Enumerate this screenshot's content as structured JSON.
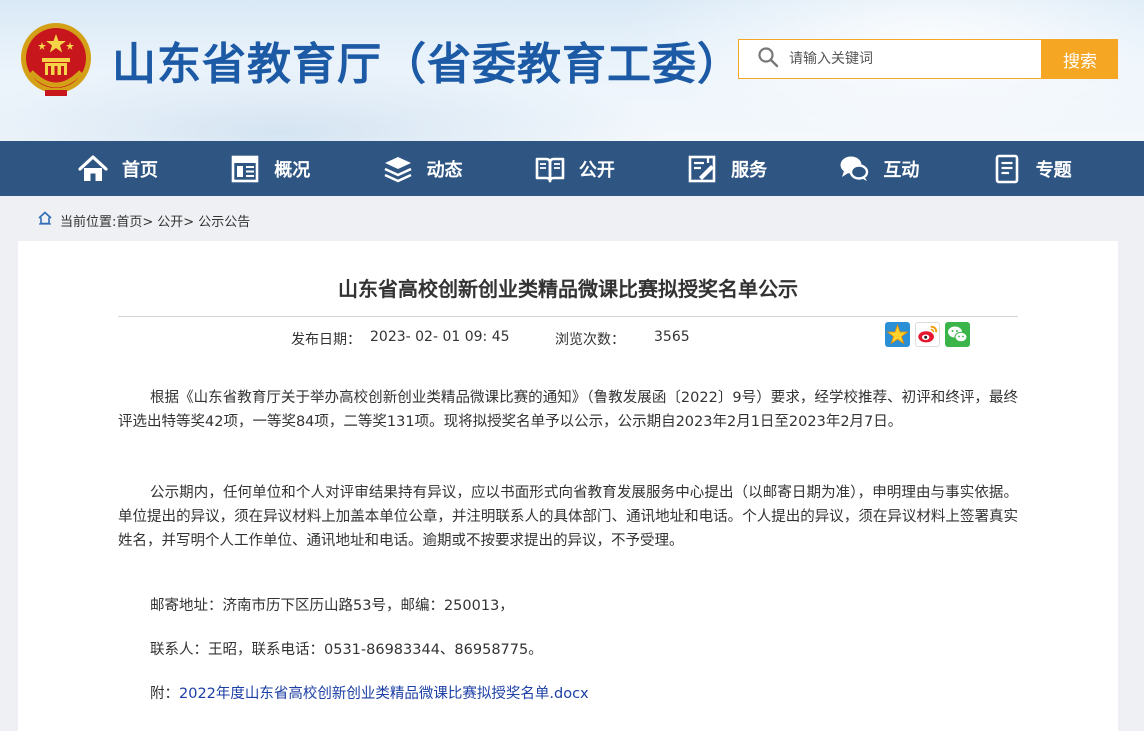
{
  "header": {
    "site_title": "山东省教育厅（省委教育工委）",
    "search_placeholder": "请输入关键词",
    "search_button": "搜索"
  },
  "nav": {
    "items": [
      {
        "label": "首页",
        "icon": "home-icon"
      },
      {
        "label": "概况",
        "icon": "overview-icon"
      },
      {
        "label": "动态",
        "icon": "news-stack-icon"
      },
      {
        "label": "公开",
        "icon": "open-book-icon"
      },
      {
        "label": "服务",
        "icon": "service-icon"
      },
      {
        "label": "互动",
        "icon": "chat-bubbles-icon"
      },
      {
        "label": "专题",
        "icon": "document-icon"
      }
    ]
  },
  "breadcrumb": {
    "prefix": "当前位置:",
    "items": [
      "首页>",
      "公开>",
      "公示公告"
    ]
  },
  "article": {
    "title": "山东省高校创新创业类精品微课比赛拟授奖名单公示",
    "publish_label": "发布日期：",
    "publish_date": "2023- 02- 01 09: 45",
    "views_label": "浏览次数：",
    "views_count": "3565",
    "share_icons": [
      "share-star-icon",
      "weibo-icon",
      "wechat-icon"
    ],
    "paragraph1": "根据《山东省教育厅关于举办高校创新创业类精品微课比赛的通知》（鲁教发展函〔2022〕9号）要求，经学校推荐、初评和终评，最终评选出特等奖42项，一等奖84项，二等奖131项。现将拟授奖名单予以公示，公示期自2023年2月1日至2023年2月7日。",
    "paragraph2": "公示期内，任何单位和个人对评审结果持有异议，应以书面形式向省教育发展服务中心提出（以邮寄日期为准），申明理由与事实依据。单位提出的异议，须在异议材料上加盖本单位公章，并注明联系人的具体部门、通讯地址和电话。个人提出的异议，须在异议材料上签署真实姓名，并写明个人工作单位、通讯地址和电话。逾期或不按要求提出的异议，不予受理。",
    "address": "邮寄地址：济南市历下区历山路53号，邮编：250013，",
    "contact": "联系人：王昭，联系电话：0531-86983344、86958775。",
    "attachment_prefix": "附：",
    "attachment_link": "2022年度山东省高校创新创业类精品微课比赛拟授奖名单.docx"
  },
  "colors": {
    "brand_blue": "#1c5aa6",
    "nav_bg": "#2f5583",
    "search_accent": "#f5a623"
  }
}
